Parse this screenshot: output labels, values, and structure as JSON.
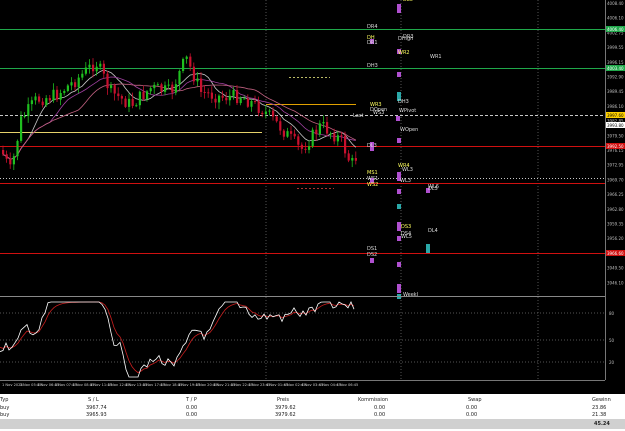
{
  "colors": {
    "background": "#000000",
    "bull_candle": "#1fbf1f",
    "bear_candle": "#c8102e",
    "green_level": "#1fa84a",
    "red_level": "#d01010",
    "orange_level": "#e0a000",
    "white_level": "#c8c8c8",
    "osc_main": "#ffffff",
    "osc_signal": "#c81e1e",
    "price_tag_yellow": "#ffd000",
    "price_tag_red": "#d01010",
    "price_tag_green": "#1fa84a",
    "price_tag_white": "#ffffff"
  },
  "price_axis": {
    "labels": [
      "4008.40",
      "4006.10",
      "4002.75",
      "3999.55",
      "3996.15",
      "3992.90",
      "3989.45",
      "3986.10",
      "3982.85",
      "3979.50",
      "3976.15",
      "3972.95",
      "3969.70",
      "3966.25",
      "3962.80",
      "3959.35",
      "3956.20",
      "3952.90",
      "3949.50",
      "3946.10"
    ],
    "tags": [
      {
        "text": "4006.40",
        "tone": "green"
      },
      {
        "text": "4003.40",
        "tone": "green"
      },
      {
        "text": "3997.60",
        "tone": "yellow"
      },
      {
        "text": "3993.80",
        "tone": "white"
      },
      {
        "text": "3992.50",
        "tone": "red"
      },
      {
        "text": "3966.60",
        "tone": "red"
      }
    ]
  },
  "indicator_axis": {
    "labels": [
      "80",
      "50",
      "20"
    ]
  },
  "time_axis": {
    "labels": [
      "1 Nov 2024",
      "3 Nov 05:45",
      "3 Nov 06:45",
      "3 Nov 07:45",
      "3 Nov 08:45",
      "3 Nov 11:45",
      "3 Nov 12:45",
      "3 Nov 13:45",
      "3 Nov 17:45",
      "3 Nov 18:45",
      "3 Nov 19:45",
      "3 Nov 20:45",
      "3 Nov 21:45",
      "3 Nov 22:45",
      "3 Nov 23:45",
      "4 Nov 01:45",
      "4 Nov 02:45",
      "4 Nov 03:45",
      "4 Nov 04:45",
      "4 Nov 06:45"
    ]
  },
  "level_labels": [
    "DR4",
    "DH",
    "DR1",
    "DHigh",
    "DR3",
    "WR2",
    "WR1",
    "DH3",
    "DH3",
    "WR3",
    "DOpen",
    "WPivot",
    "WOpen",
    "WR4",
    "DL3",
    "WL3",
    "WS1",
    "WS2",
    "WL3",
    "DS1",
    "DS2",
    "DS3",
    "DS4",
    "DL4",
    "DL5",
    "DL6",
    "WS3",
    "WL5",
    "WL6",
    "MS1",
    "Last",
    "Weekl"
  ],
  "terminal": {
    "headers": [
      "Typ",
      "S / L",
      "T / P",
      "Preis",
      "Kommission",
      "Swap",
      "Gewinn"
    ],
    "rows": [
      {
        "type": "buy",
        "sl": "3967.74",
        "tp": "0.00",
        "price": "3979.62",
        "commission": "0.00",
        "swap": "0.00",
        "profit": "23.86"
      },
      {
        "type": "buy",
        "sl": "3965.93",
        "tp": "0.00",
        "price": "3979.62",
        "commission": "0.00",
        "swap": "0.00",
        "profit": "21.38"
      }
    ],
    "total": "45.24"
  }
}
